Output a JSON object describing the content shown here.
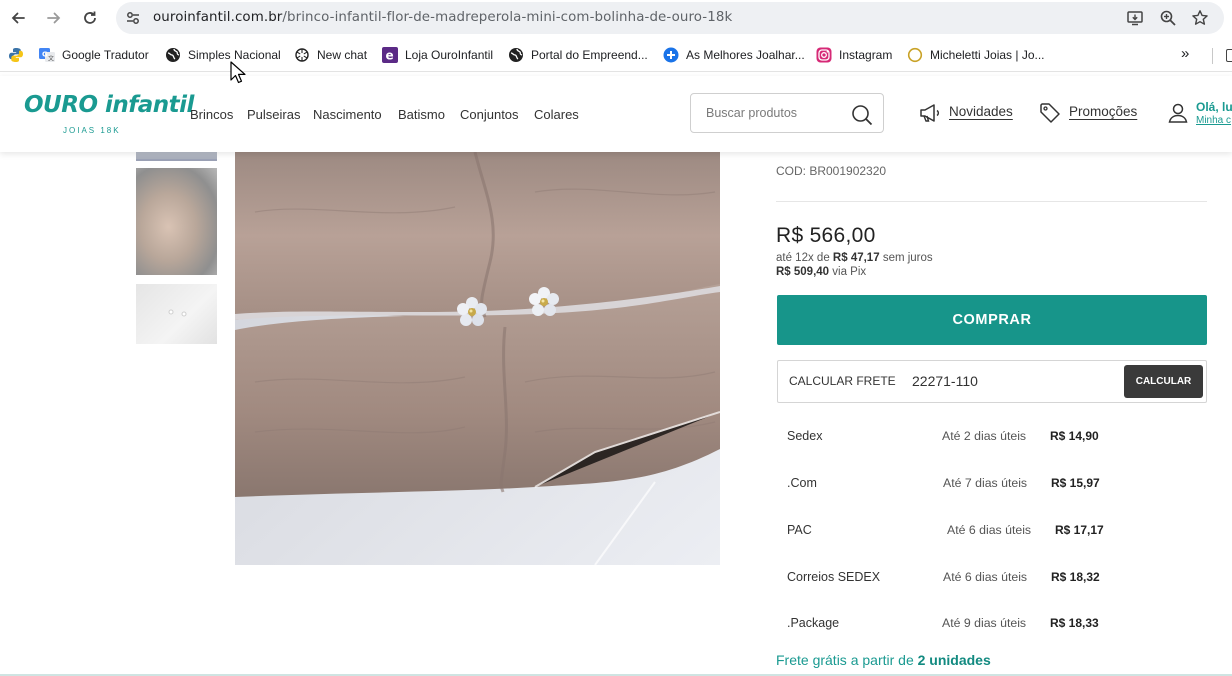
{
  "browser": {
    "url_domain": "ouroinfantil.com.br",
    "url_path": "/brinco-infantil-flor-de-madreperola-mini-com-bolinha-de-ouro-18k",
    "icons": [
      "back-arrow-icon",
      "forward-arrow-icon",
      "reload-icon",
      "site-settings-icon",
      "install-app-icon",
      "zoom-icon",
      "bookmark-star-icon"
    ]
  },
  "bookmarks": [
    {
      "label": "",
      "icon": "python-icon"
    },
    {
      "label": "Google Tradutor",
      "icon": "google-translate-icon"
    },
    {
      "label": "Simples Nacional",
      "icon": "globe-icon"
    },
    {
      "label": "New chat",
      "icon": "chatgpt-icon"
    },
    {
      "label": "Loja OuroInfantil",
      "icon": "ecommerce-e-icon"
    },
    {
      "label": "Portal do Empreend...",
      "icon": "globe-icon"
    },
    {
      "label": "As Melhores Joalhar...",
      "icon": "plus-circle-icon"
    },
    {
      "label": "Instagram",
      "icon": "instagram-icon"
    },
    {
      "label": "Micheletti Joias | Jo...",
      "icon": "ring-icon"
    }
  ],
  "bookmarks_overflow": "»",
  "site": {
    "logo_text": "OURO infantil",
    "logo_sub": "JOIAS 18K",
    "menu": [
      "Brincos",
      "Pulseiras",
      "Nascimento",
      "Batismo",
      "Conjuntos",
      "Colares"
    ],
    "search_placeholder": "Buscar produtos",
    "novidades": "Novidades",
    "promocoes": "Promoções",
    "greeting": "Olá, lu",
    "account": "Minha c"
  },
  "product": {
    "cod": "COD: BR001902320",
    "price": "R$ 566,00",
    "installments_prefix": "até 12x de",
    "installments_value": "R$ 47,17",
    "installments_suffix": "sem juros",
    "pix_value": "R$ 509,40",
    "pix_suffix": "via Pix",
    "buy_label": "COMPRAR"
  },
  "shipping": {
    "label": "CALCULAR FRETE",
    "cep": "22271-110",
    "button": "CALCULAR",
    "options": [
      {
        "name": "Sedex",
        "time": "Até 2 dias úteis",
        "price": "R$ 14,90"
      },
      {
        "name": ".Com",
        "time": "Até 7 dias úteis",
        "price": "R$ 15,97"
      },
      {
        "name": "PAC",
        "time": "Até 6 dias úteis",
        "price": "R$ 17,17"
      },
      {
        "name": "Correios SEDEX",
        "time": "Até 6 dias úteis",
        "price": "R$ 18,32"
      },
      {
        "name": ".Package",
        "time": "Até 9 dias úteis",
        "price": "R$ 18,33"
      }
    ],
    "free_prefix": "Frete grátis a partir de",
    "free_bold": "2 unidades"
  },
  "colors": {
    "brand": "#17958a",
    "dark_button": "#3a3a3a"
  }
}
